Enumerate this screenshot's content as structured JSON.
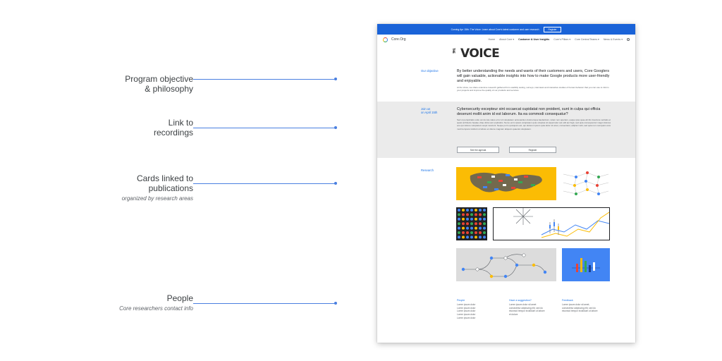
{
  "annotations": [
    {
      "title_lines": [
        "Program objective",
        "& philosophy"
      ],
      "subtitle": ""
    },
    {
      "title_lines": [
        "Link to",
        "recordings"
      ],
      "subtitle": ""
    },
    {
      "title_lines": [
        "Cards linked to",
        "publications"
      ],
      "subtitle": "organized by research areas"
    },
    {
      "title_lines": [
        "People"
      ],
      "subtitle": "Core researchers contact info"
    }
  ],
  "banner": {
    "text": "Coming Apr 15th: The Voice. Learn about Core's latest customer and user research",
    "register_label": "Register"
  },
  "nav": {
    "site_name": "Core.Org",
    "items": [
      "Home",
      "About Core ▾",
      "Customer & User Insights",
      "Core's Pillars ▾",
      "Core Central Teams ▾",
      "News & Events ▾"
    ],
    "active_index": 2
  },
  "hero": {
    "logo_the": "THE",
    "logo_text": "VOICE"
  },
  "objective": {
    "label": "Our objective",
    "lead": "By better understanding the needs and wants of their customers and users, Core Googlers will gain valuable, actionable insights into how to make Google products more user-friendly and enjoyable.",
    "body": "At the Voice, we share extensive research gathered from usability testing, surveys, interviews and interactive studies of human behavior that you can use to inform your projects and improve the quality of our products and services."
  },
  "join": {
    "label_lines": [
      "Join us",
      "on April 15th"
    ],
    "lead": "Cybersecurity excepteur sint occaecat cupidatat non proident, sunt in culpa qui officia deserunt mollit anim id est laborum. Ita ea commodi consequatur?",
    "body": "Sed ut perspiciatis unde omnis iste natus error sit voluptatem accusantium doloremque laudantium, totam rem aperiam, eaque ipsa quae ab illo inventore veritatis et quasi architecto beatae vitae dicta sunt explicabo. Nemo enim ipsam voluptatem quia voluptas sit aspernatur aut odit aut fugit, sed quia consequuntur magni dolores eos qui ratione voluptatem sequi nesciunt. Neque porro quisquam est, qui dolorem ipsum quia dolor sit amet, consectetur, adipisci velit, sed quia non numquam eius modi tempora incidunt ut labore et dolore magnam aliquam quaerat voluptatem.",
    "agenda_label": "See the agenda",
    "register_label": "Register"
  },
  "research": {
    "label": "Research"
  },
  "footer": {
    "people": {
      "heading": "People",
      "lines": [
        "Lorem ipsum dolor",
        "Lorem ipsum dolor",
        "Lorem ipsum dolor",
        "Lorem ipsum dolor",
        "Lorem ipsum dolor"
      ]
    },
    "suggestion": {
      "heading": "Have a suggestion?",
      "lines": [
        "Lorem ipsum dolor sit amet",
        "consectetur adipiscing elit, sed do",
        "eiusmod tempor incididunt ut labore",
        "et dolore"
      ]
    },
    "feedback": {
      "heading": "Feedback",
      "lines": [
        "Lorem ipsum dolor sit amet,",
        "consectetur adipiscing elit, sed do",
        "eiusmod tempor incididunt ut labore"
      ]
    }
  },
  "colors": {
    "accent": "#1a73e8",
    "banner": "#1a63d8",
    "card_yellow": "#fbbc04",
    "card_blue": "#4285f4",
    "leader": "#4a7fe0"
  }
}
